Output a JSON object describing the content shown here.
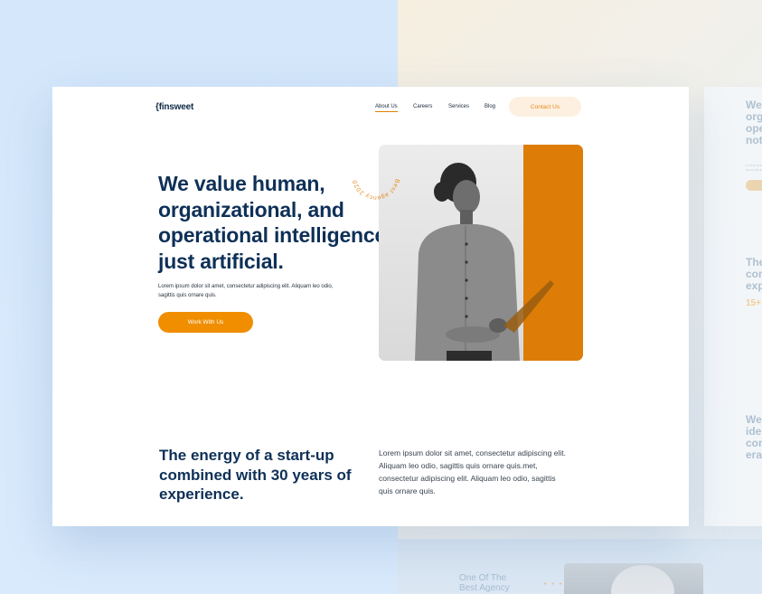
{
  "nav": {
    "logo": "{finsweet",
    "links": [
      "About Us",
      "Careers",
      "Services",
      "Blog"
    ],
    "contact_label": "Contact Us"
  },
  "hero": {
    "title": "We value human, organizational, and operational intelligence not just artificial.",
    "text": "Lorem ipsum dolor sit amet, consectetur adipiscing elit. Aliquam leo odio, sagittis quis ornare quis.",
    "button_label": "Work With Us",
    "badge_text": "Best agency 2020 • 2021 | london"
  },
  "section2": {
    "title": "The energy of a start-up combined with 30 years of experience.",
    "text": "Lorem ipsum dolor sit amet, consectetur adipiscing elit. Aliquam leo odio, sagittis quis ornare quis.met, consectetur adipiscing elit. Aliquam leo odio, sagittis quis ornare quis."
  },
  "ghost": {
    "heading1": "We org ope not",
    "heading2": "The com exp",
    "stat": "15+",
    "heading3": "We iden cor era",
    "bottom_title": "One Of The Best Agency",
    "bottom_dots": "• • •"
  },
  "colors": {
    "accent": "#f08e00",
    "navy": "#0e3057",
    "photo_orange": "#dd7d07"
  }
}
